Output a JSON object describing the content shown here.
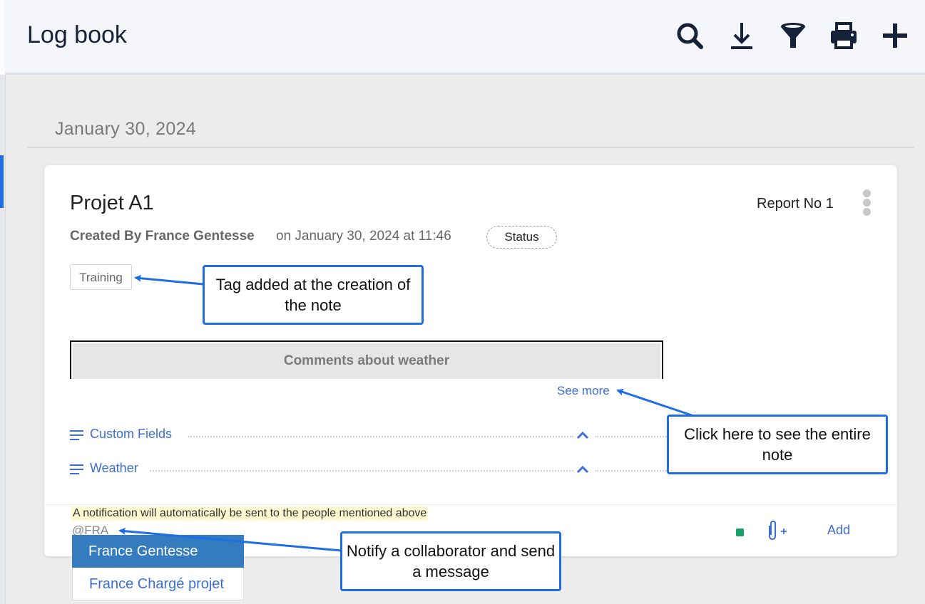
{
  "header": {
    "title": "Log book",
    "tools": [
      {
        "icon": "search-icon"
      },
      {
        "icon": "download-icon"
      },
      {
        "icon": "filter-icon"
      },
      {
        "icon": "print-icon"
      },
      {
        "icon": "plus-icon"
      }
    ]
  },
  "date_heading": "January 30, 2024",
  "note": {
    "title": "Projet A1",
    "report_no": "Report No 1",
    "created_by": "Created By France Gentesse",
    "created_on": "on January 30, 2024 at 11:46",
    "status": "Status",
    "tag": "Training",
    "weather_comments": "Comments about weather",
    "see_more": "See more",
    "sections": [
      {
        "label": "Custom Fields"
      },
      {
        "label": "Weather"
      }
    ],
    "notice": "A notification will automatically be sent to the people mentioned above",
    "mention_input": "@FRA",
    "add_label": "Add"
  },
  "mention_suggestions": [
    "France Gentesse",
    "France Chargé projet"
  ],
  "callouts": {
    "tag": "Tag added at the creation of the note",
    "see_more": "Click here to see the entire note",
    "notify": "Notify a collaborator and send a message"
  },
  "colors": {
    "accent": "#3b6fd6",
    "callout_border": "#1f6de4",
    "active_suggestion": "#347bbf",
    "notice_bg": "#fcf8cf",
    "header_icon": "#16213a"
  }
}
